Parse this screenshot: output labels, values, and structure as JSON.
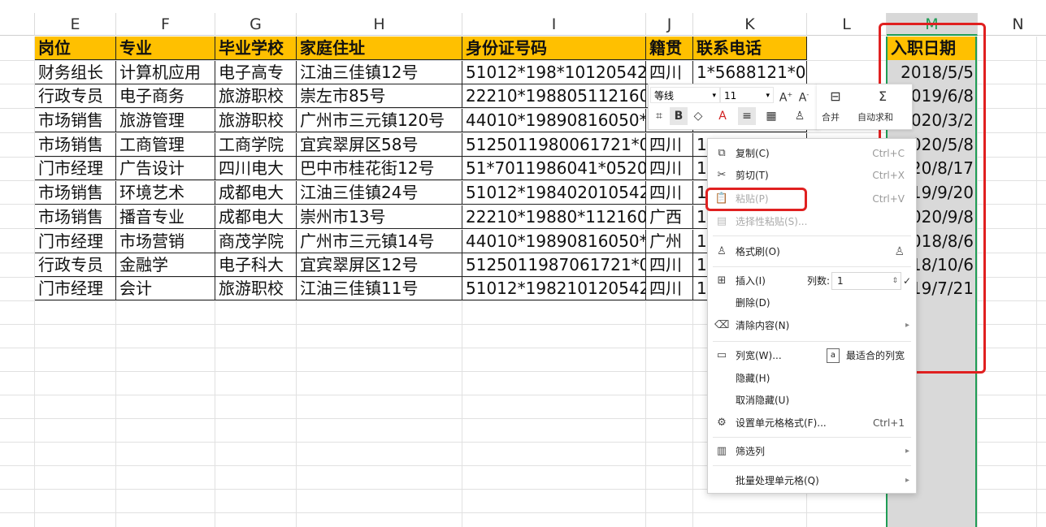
{
  "columns": [
    "E",
    "F",
    "G",
    "H",
    "I",
    "J",
    "K",
    "L",
    "M",
    "N"
  ],
  "header_row": [
    "岗位",
    "专业",
    "毕业学校",
    "家庭住址",
    "身份证号码",
    "籍贯",
    "联系电话"
  ],
  "m_header": "入职日期",
  "rows": [
    [
      "财务组长",
      "计算机应用",
      "电子高专",
      "江油三佳镇12号",
      "51012*198*10120542",
      "四川",
      "1*5688121*0"
    ],
    [
      "行政专员",
      "电子商务",
      "旅游职校",
      "崇左市85号",
      "22210*198805112160",
      "",
      ""
    ],
    [
      "市场销售",
      "旅游管理",
      "旅游职校",
      "广州市三元镇120号",
      "44010*19890816050*",
      "",
      ""
    ],
    [
      "市场销售",
      "工商管理",
      "工商学院",
      "宜宾翠屏区58号",
      "5125011980061721*0",
      "四川",
      "1"
    ],
    [
      "门市经理",
      "广告设计",
      "四川电大",
      "巴中市桂花街12号",
      "51*7011986041*0520",
      "四川",
      "1"
    ],
    [
      "市场销售",
      "环境艺术",
      "成都电大",
      "江油三佳镇24号",
      "51012*198402010542",
      "四川",
      "1"
    ],
    [
      "市场销售",
      "播音专业",
      "成都电大",
      "崇州市13号",
      "22210*19880*112160",
      "广西",
      "1"
    ],
    [
      "门市经理",
      "市场营销",
      "商茂学院",
      "广州市三元镇14号",
      "44010*19890816050*",
      "广州",
      "1"
    ],
    [
      "行政专员",
      "金融学",
      "电子科大",
      "宜宾翠屏区12号",
      "5125011987061721*0",
      "四川",
      "1"
    ],
    [
      "门市经理",
      "会计",
      "旅游职校",
      "江油三佳镇11号",
      "51012*198210120542",
      "四川",
      "1"
    ]
  ],
  "m_values": [
    "2018/5/5",
    "019/6/8",
    "020/3/2",
    "020/5/8",
    "20/8/17",
    "19/9/20",
    "020/9/8",
    "018/8/6",
    "18/10/6",
    "19/7/21"
  ],
  "mini_toolbar": {
    "font_name": "等线",
    "font_size": "11",
    "merge_label": "合并",
    "autosum_label": "自动求和"
  },
  "context_menu": {
    "copy": "复制(C)",
    "copy_sc": "Ctrl+C",
    "cut": "剪切(T)",
    "cut_sc": "Ctrl+X",
    "paste": "粘贴(P)",
    "paste_sc": "Ctrl+V",
    "paste_special": "选择性粘贴(S)...",
    "format_painter": "格式刷(O)",
    "insert": "插入(I)",
    "insert_cols_label": "列数:",
    "insert_cols_value": "1",
    "delete": "删除(D)",
    "clear": "清除内容(N)",
    "col_width": "列宽(W)...",
    "best_fit": "最适合的列宽",
    "hide": "隐藏(H)",
    "unhide": "取消隐藏(U)",
    "format_cells": "设置单元格格式(F)...",
    "format_cells_sc": "Ctrl+1",
    "filter_col": "筛选列",
    "batch": "批量处理单元格(Q)"
  },
  "colors": {
    "header_fill": "#ffc000",
    "select_green": "#1f9d55",
    "highlight_red": "#e02020"
  }
}
